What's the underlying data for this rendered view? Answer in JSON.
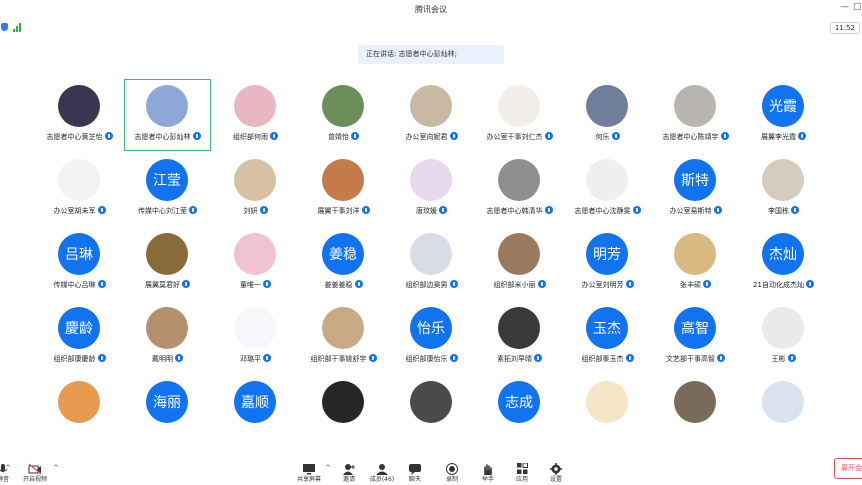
{
  "window": {
    "title": "腾讯会议",
    "min": "—",
    "max": "□"
  },
  "status": {
    "clock": "11:52"
  },
  "speaking": "正在讲话: 志愿者中心彭灿林;",
  "participants": [
    {
      "name": "志愿者中心黄芝怡",
      "avatar_text": "",
      "color": "#3a3550"
    },
    {
      "name": "志愿者中心彭灿林",
      "avatar_text": "",
      "color": "#8da8d8",
      "active": true
    },
    {
      "name": "组织部何雨",
      "avatar_text": "",
      "color": "#e9b7c4"
    },
    {
      "name": "曾婧怡",
      "avatar_text": "",
      "color": "#6c8e5a"
    },
    {
      "name": "办公室向妮君",
      "avatar_text": "",
      "color": "#c9b9a3"
    },
    {
      "name": "办公室干事刘仁杰",
      "avatar_text": "",
      "color": "#f1eee9"
    },
    {
      "name": "何乐",
      "avatar_text": "",
      "color": "#6f7f9b"
    },
    {
      "name": "志愿者中心陈靖宇",
      "avatar_text": "",
      "color": "#b8b4b0"
    },
    {
      "name": "展翼李光霞",
      "avatar_text": "光霞",
      "color": "#1273f0"
    },
    {
      "name": "办公室胡未军",
      "avatar_text": "",
      "color": "#f3f3f3"
    },
    {
      "name": "传媒中心刘江莹",
      "avatar_text": "江莹",
      "color": "#1273f0"
    },
    {
      "name": "刘妍",
      "avatar_text": "",
      "color": "#d6c2a3"
    },
    {
      "name": "展翼干事刘洋",
      "avatar_text": "",
      "color": "#c47a4a"
    },
    {
      "name": "唐玟媛",
      "avatar_text": "",
      "color": "#e9d9ee"
    },
    {
      "name": "志愿者中心韩清华",
      "avatar_text": "",
      "color": "#8f8f8f"
    },
    {
      "name": "志愿者中心沈静雯",
      "avatar_text": "",
      "color": "#efefef"
    },
    {
      "name": "办公室易斯特",
      "avatar_text": "斯特",
      "color": "#1273f0"
    },
    {
      "name": "李国栋",
      "avatar_text": "",
      "color": "#d3ccbf"
    },
    {
      "name": "传媒中心吕琳",
      "avatar_text": "吕琳",
      "color": "#1273f0"
    },
    {
      "name": "展翼莫君好",
      "avatar_text": "",
      "color": "#8a6b3a"
    },
    {
      "name": "董唯一",
      "avatar_text": "",
      "color": "#f1c2d3"
    },
    {
      "name": "姜姜姜稳",
      "avatar_text": "姜稳",
      "color": "#1273f0"
    },
    {
      "name": "组织部边昊男",
      "avatar_text": "",
      "color": "#d9dce6"
    },
    {
      "name": "组织部米小丽",
      "avatar_text": "",
      "color": "#9a7a5f"
    },
    {
      "name": "办公室刘明芳",
      "avatar_text": "明芳",
      "color": "#1273f0"
    },
    {
      "name": "张丰硕",
      "avatar_text": "",
      "color": "#d8b981"
    },
    {
      "name": "21自动化成杰灿",
      "avatar_text": "杰灿",
      "color": "#1273f0"
    },
    {
      "name": "组织部康慶龄",
      "avatar_text": "慶龄",
      "color": "#1273f0"
    },
    {
      "name": "戴明明",
      "avatar_text": "",
      "color": "#b58f6e"
    },
    {
      "name": "邓璐平",
      "avatar_text": "",
      "color": "#f6f7fb"
    },
    {
      "name": "组织部干事姚舒宇",
      "avatar_text": "",
      "color": "#c9aa85"
    },
    {
      "name": "组织部康怡乐",
      "avatar_text": "怡乐",
      "color": "#1273f0"
    },
    {
      "name": "素拓刘早晴",
      "avatar_text": "",
      "color": "#3a3a3a"
    },
    {
      "name": "组织部秦玉杰",
      "avatar_text": "玉杰",
      "color": "#1273f0"
    },
    {
      "name": "文艺部干事高智",
      "avatar_text": "高智",
      "color": "#1273f0"
    },
    {
      "name": "王彬",
      "avatar_text": "",
      "color": "#eaeaea"
    },
    {
      "name": "",
      "avatar_text": "",
      "color": "#e89a4e"
    },
    {
      "name": "",
      "avatar_text": "海丽",
      "color": "#1273f0"
    },
    {
      "name": "",
      "avatar_text": "嘉顺",
      "color": "#1273f0"
    },
    {
      "name": "",
      "avatar_text": "",
      "color": "#262626"
    },
    {
      "name": "",
      "avatar_text": "",
      "color": "#4a4a4a"
    },
    {
      "name": "",
      "avatar_text": "志成",
      "color": "#1273f0"
    },
    {
      "name": "",
      "avatar_text": "",
      "color": "#f6e6c7"
    },
    {
      "name": "",
      "avatar_text": "",
      "color": "#7a6a5a"
    },
    {
      "name": "",
      "avatar_text": "",
      "color": "#d8e2f0"
    }
  ],
  "toolbar": {
    "mute": "静音",
    "video": "开启视频",
    "share": "共享屏幕",
    "invite": "邀请",
    "members": "成员(46)",
    "chat": "聊天",
    "record": "录制",
    "hand": "举手",
    "apps": "应用",
    "settings": "设置",
    "leave": "离开会"
  },
  "colors": {
    "accent": "#1273f0",
    "active_border": "#3bbf72",
    "danger": "#e34d59"
  }
}
